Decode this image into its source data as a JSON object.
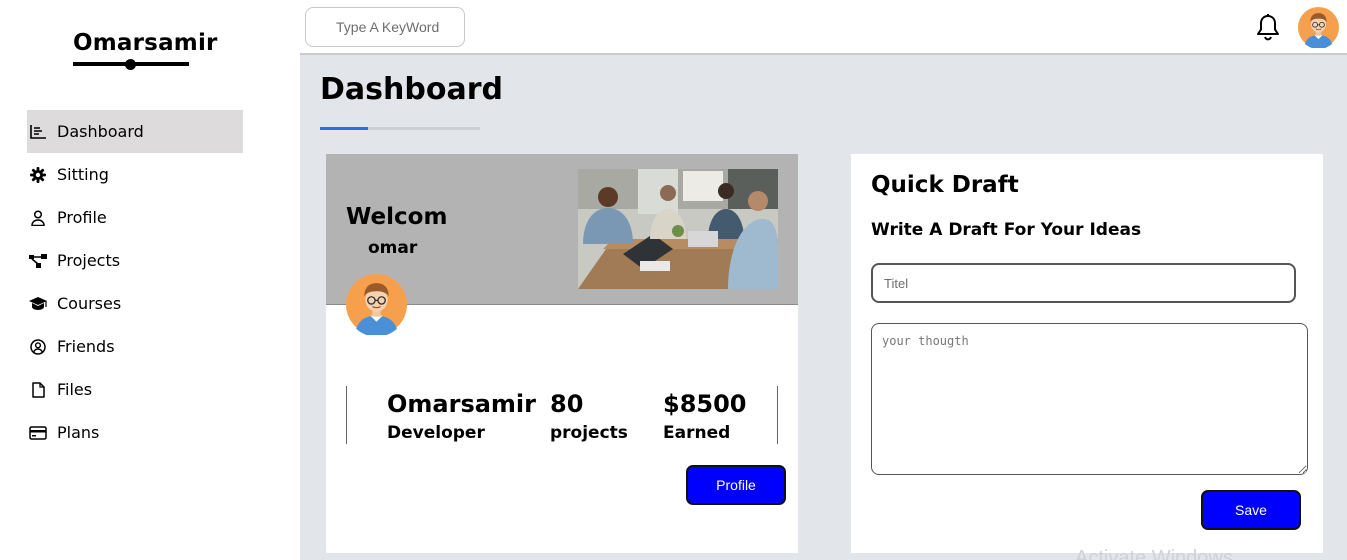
{
  "sidebar": {
    "logo": "Omarsamir",
    "items": [
      {
        "label": "Dashboard",
        "icon": "chart-icon"
      },
      {
        "label": "Sitting",
        "icon": "gear-icon"
      },
      {
        "label": "Profile",
        "icon": "user-icon"
      },
      {
        "label": "Projects",
        "icon": "diagram-icon"
      },
      {
        "label": "Courses",
        "icon": "graduation-cap-icon"
      },
      {
        "label": "Friends",
        "icon": "user-circle-icon"
      },
      {
        "label": "Files",
        "icon": "file-icon"
      },
      {
        "label": "Plans",
        "icon": "credit-card-icon"
      }
    ],
    "active_index": 0
  },
  "topbar": {
    "search_placeholder": "Type A KeyWord"
  },
  "main": {
    "title": "Dashboard"
  },
  "welcome": {
    "title": "Welcom",
    "name": "omar",
    "stats": [
      {
        "value": "Omarsamir",
        "label": "Developer"
      },
      {
        "value": "80",
        "label": "projects"
      },
      {
        "value": "$8500",
        "label": "Earned"
      }
    ],
    "button": "Profile"
  },
  "draft": {
    "title": "Quick Draft",
    "subtitle": "Write A Draft For Your Ideas",
    "input_placeholder": "Titel",
    "textarea_placeholder": "your thougth",
    "button": "Save"
  },
  "overlay": {
    "watermark": "Activate Windows"
  },
  "colors": {
    "accent": "#1d75e8",
    "button": "#0000ff",
    "page_bg": "#e2e6ea",
    "active_nav": "#dddbdc",
    "banner": "#b3b3b3"
  }
}
